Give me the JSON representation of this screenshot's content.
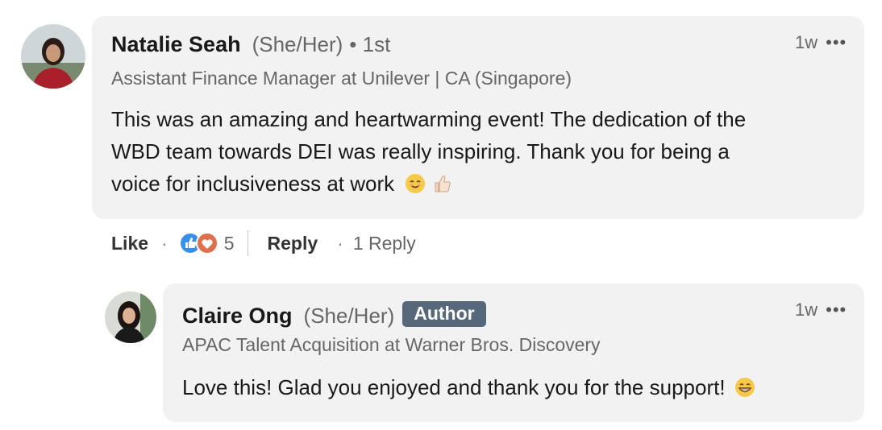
{
  "comment": {
    "author_name": "Natalie Seah",
    "pronouns": "(She/Her)",
    "connection": "• 1st",
    "headline": "Assistant Finance Manager at Unilever | CA (Singapore)",
    "time": "1w",
    "text_line1": "This was an amazing and heartwarming event! The dedication of the",
    "text_line2": "WBD team towards DEI was really inspiring. Thank you for being a",
    "text_line3": "voice for inclusiveness at work",
    "emojis": [
      "smiling-face",
      "thumbs-up-light-skin"
    ]
  },
  "actions": {
    "like_label": "Like",
    "dot": "·",
    "reaction_count": "5",
    "reply_label": "Reply",
    "replies_label": "1 Reply"
  },
  "reply": {
    "author_name": "Claire Ong",
    "pronouns": "(She/Her)",
    "badge": "Author",
    "headline": "APAC Talent Acquisition at Warner Bros. Discovery",
    "time": "1w",
    "text": "Love this! Glad you enjoyed and thank you for the support!",
    "emoji": "grinning-face"
  },
  "colors": {
    "bubble": "#f2f2f2",
    "author_badge": "#56687a",
    "like_blue": "#378fe9",
    "love_red": "#df704d"
  }
}
